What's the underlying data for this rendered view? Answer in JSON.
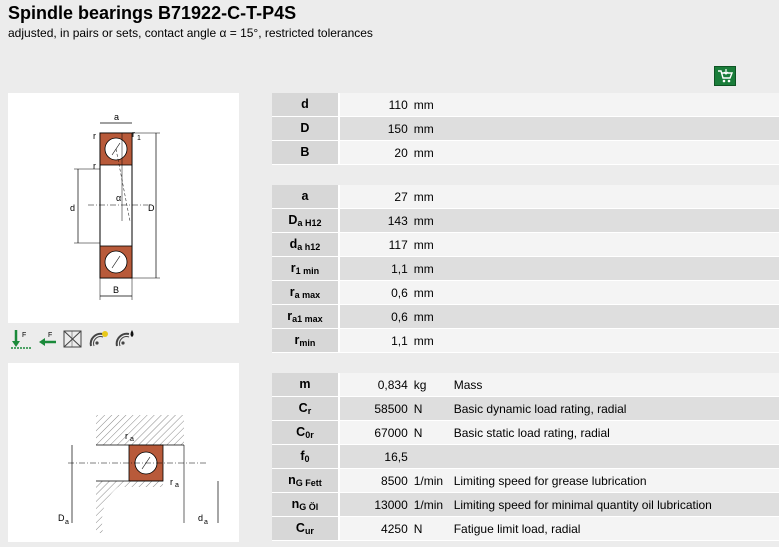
{
  "header": {
    "title": "Spindle bearings B71922-C-T-P4S",
    "subtitle": "adjusted, in pairs or sets, contact angle α = 15°, restricted tolerances"
  },
  "cart_icon": "shopping-cart-icon",
  "diagram1_labels": {
    "a": "a",
    "r1": "r",
    "r1sub": "1",
    "r": "r",
    "d": "d",
    "D": "D",
    "alpha": "α",
    "B": "B"
  },
  "diagram2_labels": {
    "ra": "r",
    "rasub": "a",
    "Da": "D",
    "Dasub": "a",
    "da": "d",
    "dasub": "a"
  },
  "table_dimensions": [
    {
      "sym": "d",
      "sub": "",
      "value": "110",
      "unit": "mm"
    },
    {
      "sym": "D",
      "sub": "",
      "value": "150",
      "unit": "mm"
    },
    {
      "sym": "B",
      "sub": "",
      "value": "20",
      "unit": "mm"
    }
  ],
  "table_mounting": [
    {
      "sym": "a",
      "sub": "",
      "value": "27",
      "unit": "mm"
    },
    {
      "sym": "D",
      "sub": "a H12",
      "value": "143",
      "unit": "mm"
    },
    {
      "sym": "d",
      "sub": "a h12",
      "value": "117",
      "unit": "mm"
    },
    {
      "sym": "r",
      "sub": "1 min",
      "value": "1,1",
      "unit": "mm"
    },
    {
      "sym": "r",
      "sub": "a max",
      "value": "0,6",
      "unit": "mm"
    },
    {
      "sym": "r",
      "sub": "a1 max",
      "value": "0,6",
      "unit": "mm"
    },
    {
      "sym": "r",
      "sub": "min",
      "value": "1,1",
      "unit": "mm"
    }
  ],
  "table_properties": [
    {
      "sym": "m",
      "sub": "",
      "value": "0,834",
      "unit": "kg",
      "desc": "Mass"
    },
    {
      "sym": "C",
      "sub": "r",
      "value": "58500",
      "unit": "N",
      "desc": "Basic dynamic load rating, radial"
    },
    {
      "sym": "C",
      "sub": "0r",
      "value": "67000",
      "unit": "N",
      "desc": "Basic static load rating, radial"
    },
    {
      "sym": "f",
      "sub": "0",
      "value": "16,5",
      "unit": "",
      "desc": ""
    },
    {
      "sym": "n",
      "sub": "G Fett",
      "value": "8500",
      "unit": "1/min",
      "desc": "Limiting speed for grease lubrication"
    },
    {
      "sym": "n",
      "sub": "G Öl",
      "value": "13000",
      "unit": "1/min",
      "desc": "Limiting speed for minimal quantity oil lubrication"
    },
    {
      "sym": "C",
      "sub": "ur",
      "value": "4250",
      "unit": "N",
      "desc": "Fatigue limit load, radial"
    }
  ],
  "feature_icons": [
    {
      "name": "radial-load-icon",
      "label": "F",
      "sub": "r"
    },
    {
      "name": "axial-load-icon",
      "label": "F",
      "sub": "a"
    },
    {
      "name": "not-suitable-icon",
      "label": "",
      "sub": ""
    },
    {
      "name": "grease-lubrication-icon",
      "label": "",
      "sub": ""
    },
    {
      "name": "oil-lubrication-icon",
      "label": "",
      "sub": ""
    }
  ]
}
